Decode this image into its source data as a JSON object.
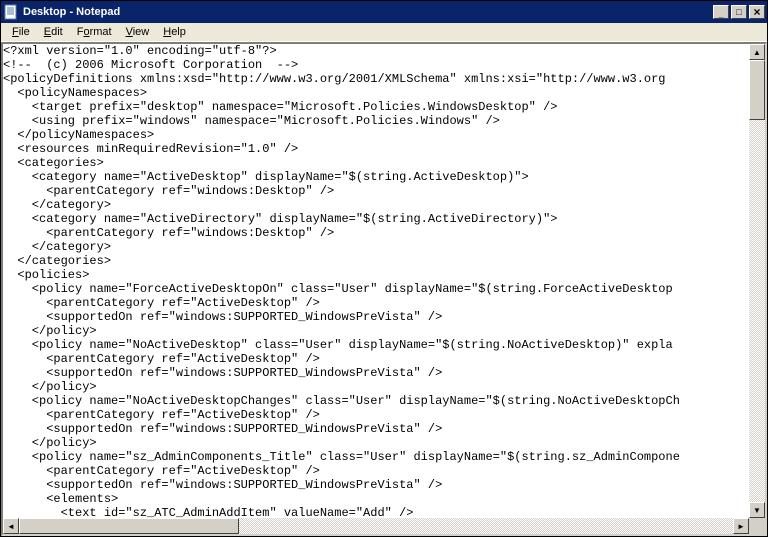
{
  "window": {
    "title": "Desktop - Notepad"
  },
  "menu": {
    "file": "File",
    "edit": "Edit",
    "format": "Format",
    "view": "View",
    "help": "Help"
  },
  "icons": {
    "minimize": "_",
    "maximize": "□",
    "close": "×",
    "up": "▲",
    "down": "▼",
    "left": "◄",
    "right": "►"
  },
  "content": "<?xml version=\"1.0\" encoding=\"utf-8\"?>\n<!--  (c) 2006 Microsoft Corporation  -->\n<policyDefinitions xmlns:xsd=\"http://www.w3.org/2001/XMLSchema\" xmlns:xsi=\"http://www.w3.org\n  <policyNamespaces>\n    <target prefix=\"desktop\" namespace=\"Microsoft.Policies.WindowsDesktop\" />\n    <using prefix=\"windows\" namespace=\"Microsoft.Policies.Windows\" />\n  </policyNamespaces>\n  <resources minRequiredRevision=\"1.0\" />\n  <categories>\n    <category name=\"ActiveDesktop\" displayName=\"$(string.ActiveDesktop)\">\n      <parentCategory ref=\"windows:Desktop\" />\n    </category>\n    <category name=\"ActiveDirectory\" displayName=\"$(string.ActiveDirectory)\">\n      <parentCategory ref=\"windows:Desktop\" />\n    </category>\n  </categories>\n  <policies>\n    <policy name=\"ForceActiveDesktopOn\" class=\"User\" displayName=\"$(string.ForceActiveDesktop\n      <parentCategory ref=\"ActiveDesktop\" />\n      <supportedOn ref=\"windows:SUPPORTED_WindowsPreVista\" />\n    </policy>\n    <policy name=\"NoActiveDesktop\" class=\"User\" displayName=\"$(string.NoActiveDesktop)\" expla\n      <parentCategory ref=\"ActiveDesktop\" />\n      <supportedOn ref=\"windows:SUPPORTED_WindowsPreVista\" />\n    </policy>\n    <policy name=\"NoActiveDesktopChanges\" class=\"User\" displayName=\"$(string.NoActiveDesktopCh\n      <parentCategory ref=\"ActiveDesktop\" />\n      <supportedOn ref=\"windows:SUPPORTED_WindowsPreVista\" />\n    </policy>\n    <policy name=\"sz_AdminComponents_Title\" class=\"User\" displayName=\"$(string.sz_AdminCompone\n      <parentCategory ref=\"ActiveDesktop\" />\n      <supportedOn ref=\"windows:SUPPORTED_WindowsPreVista\" />\n      <elements>\n        <text id=\"sz_ATC_AdminAddItem\" valueName=\"Add\" />\n        <text id=\"sz_ATC_AdminDeleteItem\" valueName=\"Delete\" />\n      </elements>"
}
